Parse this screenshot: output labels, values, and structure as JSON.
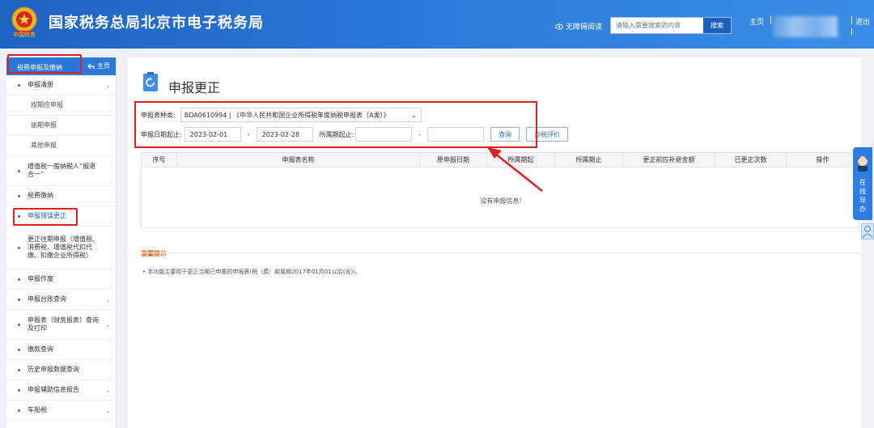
{
  "header": {
    "site_title": "国家税务总局北京市电子税务局",
    "emblem_text": "中国税务",
    "accessibility": "无障碍阅读",
    "search_placeholder": "请输入需要搜索的内容",
    "search_btn": "搜索",
    "home": "主页",
    "logout": "退出"
  },
  "sidebar": {
    "title": "税费申报及缴纳",
    "home": "主页",
    "items": [
      {
        "label": "申报清册",
        "type": "group",
        "chevron": true
      },
      {
        "label": "按期应申报",
        "type": "sub"
      },
      {
        "label": "逾期申报",
        "type": "sub"
      },
      {
        "label": "其他申报",
        "type": "sub"
      },
      {
        "label": "增值税一般纳税人“报退合一”",
        "type": "item"
      },
      {
        "label": "税费缴纳",
        "type": "item"
      },
      {
        "label": "申报错误更正",
        "type": "item",
        "active": true
      },
      {
        "label": "更正往期申报（增值税、消费税、增值税代扣代缴、扣缴企业所得税）",
        "type": "item"
      },
      {
        "label": "申报作废",
        "type": "item"
      },
      {
        "label": "申报台账查询",
        "type": "item",
        "chevron": true
      },
      {
        "label": "申报表（财务报表）查询及打印",
        "type": "item",
        "chevron": true
      },
      {
        "label": "缴款查询",
        "type": "item"
      },
      {
        "label": "历史申报数据查询",
        "type": "item"
      },
      {
        "label": "申报辅助信息报告",
        "type": "item",
        "chevron": true
      },
      {
        "label": "车船税",
        "type": "item",
        "chevron": true
      }
    ]
  },
  "main": {
    "page_title": "申报更正",
    "form": {
      "type_label": "申报表种类:",
      "type_value": "BDA0610994 | 《中华人民共和国企业所得税年度纳税申报表（A类）》",
      "date_label": "申报日期起止:",
      "date_from": "2023-02-01",
      "date_to": "2023-02-28",
      "dash": "-",
      "period_label": "所属期起止:",
      "period_from": "",
      "period_to": "",
      "query_btn": "查询",
      "eval_btn": "办税评价"
    },
    "table": {
      "columns": [
        "序号",
        "申报表名称",
        "原申报日期",
        "所属期起",
        "所属期止",
        "更正前应补退金额",
        "已更正次数",
        "操作"
      ],
      "empty_message": "没有申报信息!"
    },
    "tips": {
      "title": "温馨提示",
      "text": "• 本功能主要用于更正当期已申报的申报表(税（费）款属期2017年01月01以后(含))。"
    }
  },
  "float": {
    "guide": "在线导办"
  },
  "colors": {
    "header": "#2b78d8",
    "accent": "#1c64c6",
    "annotation": "#e02020",
    "tips": "#e36b1a"
  }
}
